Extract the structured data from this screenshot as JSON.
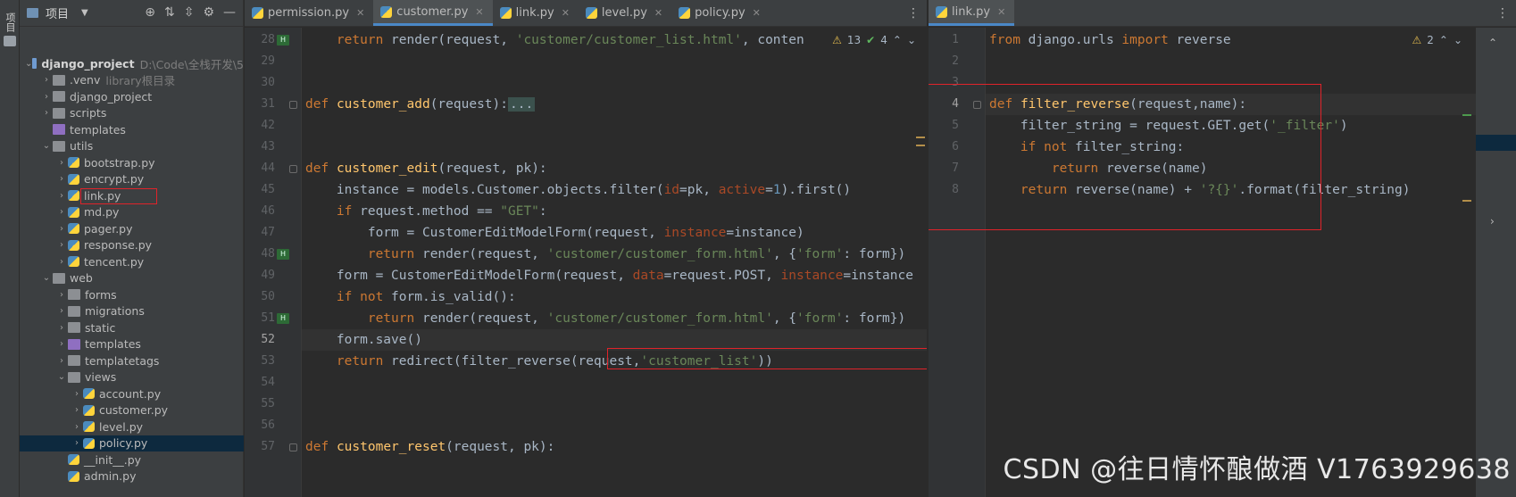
{
  "side_strip": {
    "tab_label": "项目"
  },
  "project": {
    "title": "项目",
    "tree": [
      {
        "label": "django_project",
        "hint": "D:\\Code\\全栈开发\\5",
        "depth": 0,
        "kind": "folder-root",
        "open": true
      },
      {
        "label": ".venv",
        "hint": "library根目录",
        "depth": 1,
        "kind": "folder",
        "open": false
      },
      {
        "label": "django_project",
        "hint": "",
        "depth": 1,
        "kind": "folder",
        "open": false
      },
      {
        "label": "scripts",
        "hint": "",
        "depth": 1,
        "kind": "folder",
        "open": false
      },
      {
        "label": "templates",
        "hint": "",
        "depth": 1,
        "kind": "folder-purple",
        "open": null
      },
      {
        "label": "utils",
        "hint": "",
        "depth": 1,
        "kind": "folder",
        "open": true
      },
      {
        "label": "bootstrap.py",
        "hint": "",
        "depth": 2,
        "kind": "py",
        "open": false
      },
      {
        "label": "encrypt.py",
        "hint": "",
        "depth": 2,
        "kind": "py",
        "open": false
      },
      {
        "label": "link.py",
        "hint": "",
        "depth": 2,
        "kind": "py",
        "open": false,
        "boxed": true
      },
      {
        "label": "md.py",
        "hint": "",
        "depth": 2,
        "kind": "py",
        "open": false
      },
      {
        "label": "pager.py",
        "hint": "",
        "depth": 2,
        "kind": "py",
        "open": false
      },
      {
        "label": "response.py",
        "hint": "",
        "depth": 2,
        "kind": "py",
        "open": false
      },
      {
        "label": "tencent.py",
        "hint": "",
        "depth": 2,
        "kind": "py",
        "open": false
      },
      {
        "label": "web",
        "hint": "",
        "depth": 1,
        "kind": "folder",
        "open": true
      },
      {
        "label": "forms",
        "hint": "",
        "depth": 2,
        "kind": "folder",
        "open": false
      },
      {
        "label": "migrations",
        "hint": "",
        "depth": 2,
        "kind": "folder",
        "open": false
      },
      {
        "label": "static",
        "hint": "",
        "depth": 2,
        "kind": "folder",
        "open": false
      },
      {
        "label": "templates",
        "hint": "",
        "depth": 2,
        "kind": "folder-purple",
        "open": false
      },
      {
        "label": "templatetags",
        "hint": "",
        "depth": 2,
        "kind": "folder",
        "open": false
      },
      {
        "label": "views",
        "hint": "",
        "depth": 2,
        "kind": "folder",
        "open": true
      },
      {
        "label": "account.py",
        "hint": "",
        "depth": 3,
        "kind": "py",
        "open": false
      },
      {
        "label": "customer.py",
        "hint": "",
        "depth": 3,
        "kind": "py",
        "open": false
      },
      {
        "label": "level.py",
        "hint": "",
        "depth": 3,
        "kind": "py",
        "open": false
      },
      {
        "label": "policy.py",
        "hint": "",
        "depth": 3,
        "kind": "py",
        "open": false,
        "selected": true
      },
      {
        "label": "__init__.py",
        "hint": "",
        "depth": 2,
        "kind": "py",
        "open": null
      },
      {
        "label": "admin.py",
        "hint": "",
        "depth": 2,
        "kind": "py",
        "open": null
      }
    ]
  },
  "left_editor": {
    "tabs": [
      {
        "label": "permission.py",
        "active": false
      },
      {
        "label": "customer.py",
        "active": true
      },
      {
        "label": "link.py",
        "active": false
      },
      {
        "label": "level.py",
        "active": false
      },
      {
        "label": "policy.py",
        "active": false
      }
    ],
    "inspection": {
      "warnings": "13",
      "ok": "4"
    },
    "lines": [
      {
        "num": "28",
        "html": "    <span class=\"kw\">return</span> render(request, <span class=\"str\">'customer/customer_list.html'</span>, conten"
      },
      {
        "num": "29",
        "html": ""
      },
      {
        "num": "30",
        "html": ""
      },
      {
        "num": "31",
        "html": "<span class=\"kw\">def</span> <span class=\"fn\">customer_add</span>(request):<span class=\"fold-dots\">...</span>"
      },
      {
        "num": "42",
        "html": ""
      },
      {
        "num": "43",
        "html": ""
      },
      {
        "num": "44",
        "html": "<span class=\"kw\">def</span> <span class=\"fn\">customer_edit</span>(request, pk):"
      },
      {
        "num": "45",
        "html": "    instance = models.Customer.objects.filter(<span class=\"param\">id</span>=pk, <span class=\"param\">active</span>=<span class=\"num\">1</span>).first()"
      },
      {
        "num": "46",
        "html": "    <span class=\"kw\">if</span> request.method == <span class=\"str\">\"GET\"</span>:"
      },
      {
        "num": "47",
        "html": "        form = CustomerEditModelForm(request, <span class=\"param\">instance</span>=instance)"
      },
      {
        "num": "48",
        "html": "        <span class=\"kw\">return</span> render(request, <span class=\"str\">'customer/customer_form.html'</span>, {<span class=\"str\">'form'</span>: form})"
      },
      {
        "num": "49",
        "html": "    form = CustomerEditModelForm(request, <span class=\"param\">data</span>=request.POST, <span class=\"param\">instance</span>=instance"
      },
      {
        "num": "50",
        "html": "    <span class=\"kw\">if not</span> form.is_valid():"
      },
      {
        "num": "51",
        "html": "        <span class=\"kw\">return</span> render(request, <span class=\"str\">'customer/customer_form.html'</span>, {<span class=\"str\">'form'</span>: form})"
      },
      {
        "num": "52",
        "html": "    form.save()",
        "current": true
      },
      {
        "num": "53",
        "html": "    <span class=\"kw\">return</span> redirect(filter_reverse(request,<span class=\"str\">'customer_list'</span>))"
      },
      {
        "num": "54",
        "html": ""
      },
      {
        "num": "55",
        "html": ""
      },
      {
        "num": "56",
        "html": ""
      },
      {
        "num": "57",
        "html": "<span class=\"kw\">def</span> <span class=\"fn\">customer_reset</span>(request, pk):"
      }
    ]
  },
  "right_editor": {
    "tabs": [
      {
        "label": "link.py",
        "active": true
      }
    ],
    "inspection": {
      "warnings": "2"
    },
    "lines": [
      {
        "num": "1",
        "html": "<span class=\"kw\">from</span> django.urls <span class=\"kw\">import</span> reverse"
      },
      {
        "num": "2",
        "html": ""
      },
      {
        "num": "3",
        "html": ""
      },
      {
        "num": "4",
        "html": "<span class=\"kw\">def</span> <span class=\"fn\">filter_reverse</span>(request,name):",
        "current": true
      },
      {
        "num": "5",
        "html": "    filter_string = request.GET.get(<span class=\"str\">'_filter'</span>)"
      },
      {
        "num": "6",
        "html": "    <span class=\"kw\">if not</span> filter_string:"
      },
      {
        "num": "7",
        "html": "        <span class=\"kw\">return</span> reverse(name)"
      },
      {
        "num": "8",
        "html": "    <span class=\"kw\">return</span> reverse(name) + <span class=\"str\">'?{}'</span>.format(filter_string)"
      }
    ]
  },
  "watermark": "CSDN @往日情怀酿做酒 V1763929638"
}
